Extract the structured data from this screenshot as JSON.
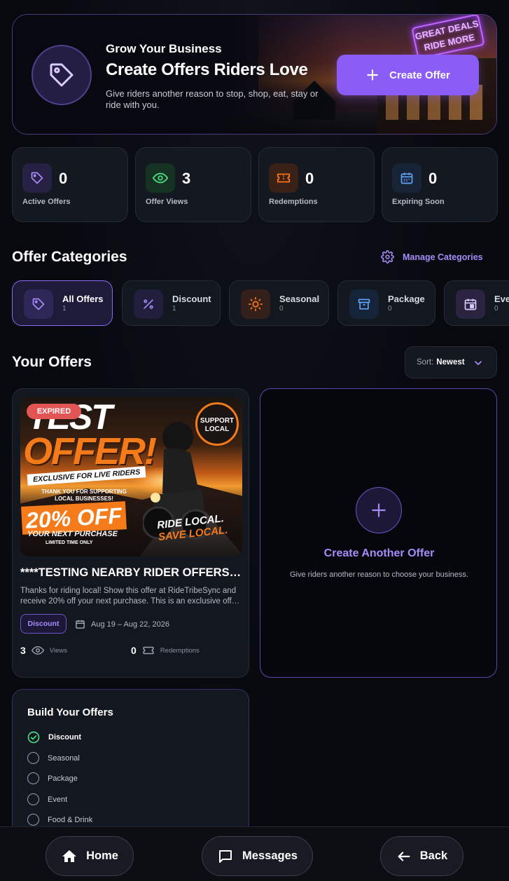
{
  "hero": {
    "kicker": "Grow Your Business",
    "title": "Create Offers Riders Love",
    "description": "Give riders another reason to stop, shop, eat, stay or ride with you.",
    "create_label": "Create Offer",
    "neon_sign": "GREAT DEALS RIDE MORE"
  },
  "stats": [
    {
      "value": "0",
      "label": "Active Offers",
      "icon": "tag-icon",
      "color": "#a78bfa"
    },
    {
      "value": "3",
      "label": "Offer Views",
      "icon": "eye-icon",
      "color": "#4ade80"
    },
    {
      "value": "0",
      "label": "Redemptions",
      "icon": "ticket-icon",
      "color": "#f97316"
    },
    {
      "value": "0",
      "label": "Expiring Soon",
      "icon": "calendar-icon",
      "color": "#60a5fa"
    }
  ],
  "categories": {
    "title": "Offer Categories",
    "manage_label": "Manage Categories",
    "items": [
      {
        "name": "All Offers",
        "count": "1",
        "icon": "tag-icon"
      },
      {
        "name": "Discount",
        "count": "1",
        "icon": "percent-icon"
      },
      {
        "name": "Seasonal",
        "count": "0",
        "icon": "sun-icon"
      },
      {
        "name": "Package",
        "count": "0",
        "icon": "archive-icon"
      },
      {
        "name": "Event",
        "count": "0",
        "icon": "calendar-icon"
      }
    ]
  },
  "offers": {
    "title": "Your Offers",
    "sort_prefix": "Sort:",
    "sort_value": "Newest"
  },
  "offer_card": {
    "status": "EXPIRED",
    "image_text": {
      "line1": "TEST",
      "line2": "OFFER!",
      "line3": "EXCLUSIVE FOR LIVE RIDERS",
      "line4": "THANK YOU FOR SUPPORTING LOCAL BUSINESSES!",
      "line5": "20% OFF",
      "line6": "YOUR NEXT PURCHASE",
      "line7": "LIMITED TIME ONLY",
      "line8": "RIDE LOCAL.",
      "line9": "SAVE LOCAL.",
      "seal": "SUPPORT LOCAL"
    },
    "title": "****TESTING NEARBY RIDER OFFERS****",
    "description": "Thanks for riding local! Show this offer at RideTribeSync and receive 20% off your next purchase. This is an exclusive offer for live riders.",
    "tag": "Discount",
    "dates": "Aug 19 – Aug 22, 2026",
    "views_value": "3",
    "views_label": "Views",
    "redemptions_value": "0",
    "redemptions_label": "Redemptions"
  },
  "create_another": {
    "title": "Create Another Offer",
    "description": "Give riders another reason to choose your business."
  },
  "build": {
    "title": "Build Your Offers",
    "items": [
      {
        "label": "Discount",
        "done": true
      },
      {
        "label": "Seasonal",
        "done": false
      },
      {
        "label": "Package",
        "done": false
      },
      {
        "label": "Event",
        "done": false
      },
      {
        "label": "Food & Drink",
        "done": false
      }
    ]
  },
  "nav": {
    "home": "Home",
    "messages": "Messages",
    "back": "Back"
  }
}
